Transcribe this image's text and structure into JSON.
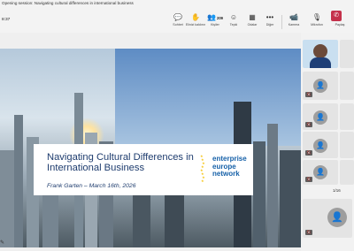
{
  "window": {
    "title": "Opening session: Navigating cultural differences in international business"
  },
  "meeting": {
    "timer": "8:37"
  },
  "toolbar": {
    "items": [
      {
        "icon": "💬",
        "label": "Sohbet"
      },
      {
        "icon": "✋",
        "label": "Elinizi kaldırın"
      },
      {
        "icon": "☺",
        "label": "Tepki"
      },
      {
        "icon": "👥",
        "label": "Kişiler",
        "count": "209"
      },
      {
        "icon": "▦",
        "label": "Odalar"
      },
      {
        "icon": "•••",
        "label": "Diğer"
      },
      {
        "icon": "📹",
        "label": "Kamera"
      },
      {
        "icon": "🎙",
        "label": "Mikrofon"
      },
      {
        "icon": "⇪",
        "label": "Paylaş"
      }
    ],
    "leave_icon": "phone-hangup",
    "accent_leave": "#c4314b"
  },
  "slide": {
    "title": "Navigating Cultural Differences in International Business",
    "subtitle": "Frank Garten – March 16th, 2026",
    "logo_text": "enterprise europe network"
  },
  "panel": {
    "pager": "1/16",
    "tile_icons": [
      "self-video",
      "avatar",
      "avatar",
      "avatar",
      "avatar",
      "avatar",
      "avatar",
      "avatar",
      "avatar"
    ]
  }
}
